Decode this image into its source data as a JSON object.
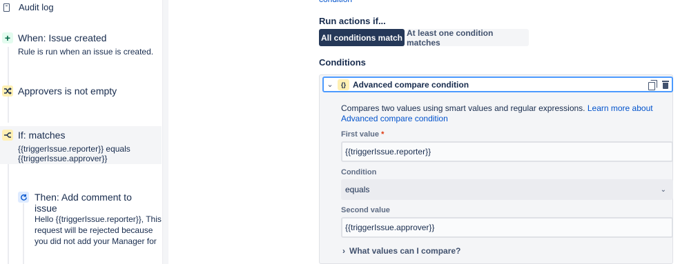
{
  "left": {
    "audit_label": "Audit log",
    "trigger": {
      "title": "When: Issue created",
      "desc": "Rule is run when an issue is created."
    },
    "condition1": {
      "title": "Approvers is not empty"
    },
    "condition2": {
      "title": "If: matches",
      "desc_line1": "{{triggerIssue.reporter}} equals",
      "desc_line2": "{{triggerIssue.approver}}"
    },
    "action": {
      "title_line1": "Then: Add comment to",
      "title_line2": "issue",
      "desc_line1": "Hello {{triggerIssue.reporter}}, This",
      "desc_line2": "request will be rejected because",
      "desc_line3": "you did not add your Manager for"
    }
  },
  "right": {
    "top_link": "condition",
    "run_actions_label": "Run actions if...",
    "all_conditions": "All conditions match",
    "one_condition": "At least one condition matches",
    "conditions_label": "Conditions",
    "card": {
      "title": "Advanced compare condition",
      "description": "Compares two values using smart values and regular expressions. ",
      "learn_more_link": "Learn more about Advanced compare condition",
      "first_value_label": "First value",
      "first_value": "{{triggerIssue.reporter}}",
      "condition_label": "Condition",
      "condition_value": "equals",
      "second_value_label": "Second value",
      "second_value": "{{triggerIssue.approver}}",
      "compare_link": "What values can I compare?"
    }
  },
  "colors": {
    "accent": "#0052CC",
    "selected_segment": "#253858",
    "focus_border": "#4C9AFF",
    "required": "#DE350B"
  },
  "icons": {
    "audit": "document-icon",
    "trigger": "plus-icon",
    "condition": "shuffle-icon",
    "branch": "branch-icon",
    "action": "refresh-icon",
    "brace": "braces-icon",
    "copy": "copy-icon",
    "delete": "trash-icon"
  }
}
